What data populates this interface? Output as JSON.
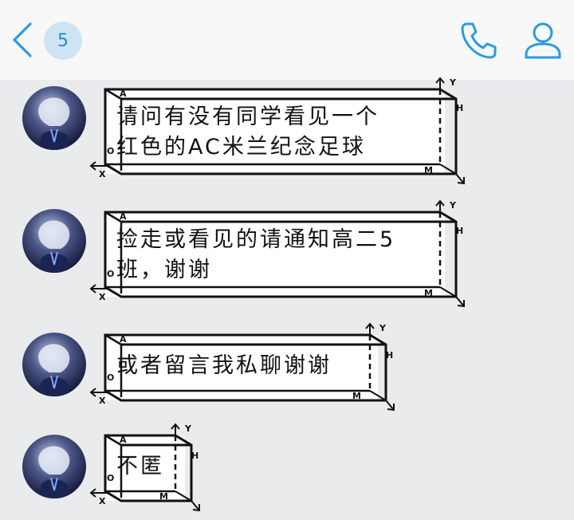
{
  "header": {
    "unread_count": "5",
    "back_icon": "back-arrow-icon",
    "phone_icon": "phone-icon",
    "profile_icon": "profile-icon",
    "accent_color": "#2a9be3"
  },
  "messages": [
    {
      "lines": [
        "请问有没有同学看见一个",
        "红色的AC米兰纪念足球"
      ]
    },
    {
      "lines": [
        "捡走或看见的请通知高二5",
        "班，谢谢"
      ]
    },
    {
      "lines": [
        "或者留言我私聊谢谢"
      ]
    },
    {
      "lines": [
        "不匿"
      ]
    }
  ],
  "bubble_labels": {
    "a": "A",
    "o": "O",
    "x": "X",
    "y": "Y",
    "h": "H",
    "m": "M"
  }
}
